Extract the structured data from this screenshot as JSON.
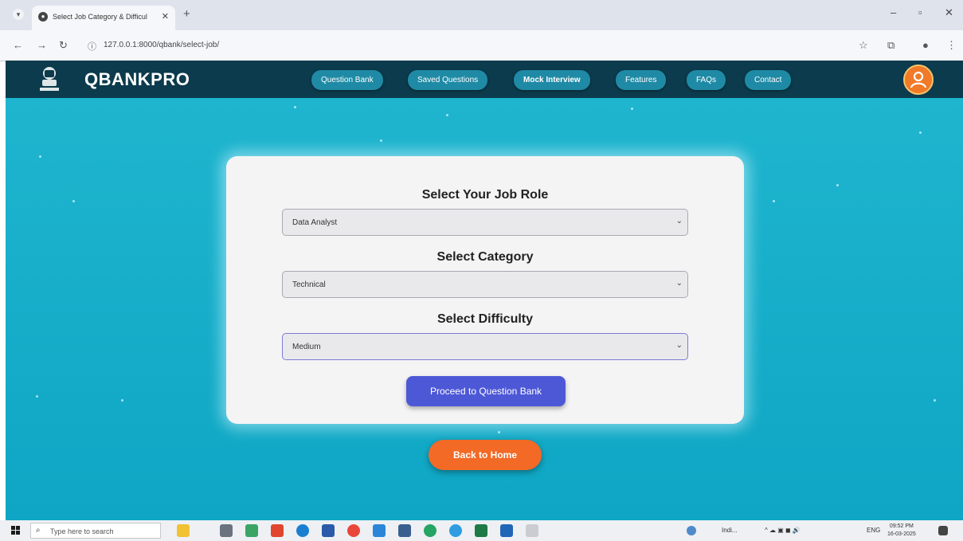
{
  "browser": {
    "tab_title": "Select Job Category & Difficul",
    "url": "127.0.0.1:8000/qbank/select-job/"
  },
  "header": {
    "brand": "QBANKPRO",
    "nav": [
      {
        "label": "Question Bank",
        "active": false
      },
      {
        "label": "Saved Questions",
        "active": false
      },
      {
        "label": "Mock Interview",
        "active": true
      },
      {
        "label": "Features",
        "active": false
      },
      {
        "label": "FAQs",
        "active": false
      },
      {
        "label": "Contact",
        "active": false
      }
    ]
  },
  "form": {
    "job_role_label": "Select Your Job Role",
    "job_role_value": "Data Analyst",
    "category_label": "Select Category",
    "category_value": "Technical",
    "difficulty_label": "Select Difficulty",
    "difficulty_value": "Medium",
    "proceed_label": "Proceed to Question Bank"
  },
  "back_home_label": "Back to Home",
  "taskbar": {
    "search_placeholder": "Type here to search",
    "weather": "Indi...",
    "lang": "ENG",
    "time": "09:52 PM",
    "date": "16-03-2025"
  },
  "colors": {
    "header_bg": "#0b3b4c",
    "nav_pill": "#1f8aa5",
    "main_bg": "#15aecb",
    "proceed_btn": "#4d58d6",
    "back_btn": "#f26a25"
  }
}
